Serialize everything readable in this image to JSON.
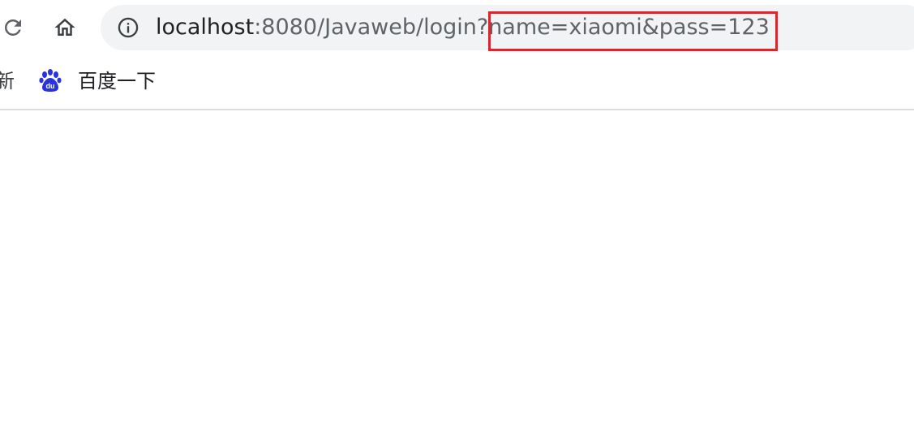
{
  "toolbar": {
    "reload_icon": "reload-icon",
    "home_icon": "home-icon"
  },
  "omnibox": {
    "info_icon": "info-icon",
    "url_host": "localhost",
    "url_rest": ":8080/Javaweb/login?name=xiaomi&pass=123",
    "highlight_color": "#e8202a"
  },
  "bookmarks": {
    "partial_label": "新",
    "items": [
      {
        "label": "百度一下",
        "icon": "baidu-paw-icon",
        "color": "#2932e1"
      }
    ]
  }
}
